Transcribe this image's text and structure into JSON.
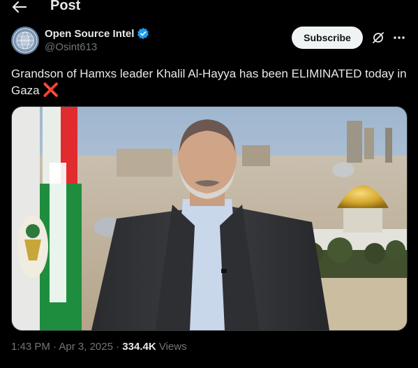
{
  "header": {
    "title": "Post",
    "back_icon": "arrow-left-icon"
  },
  "author": {
    "name": "Open Source Intel",
    "handle": "@Osint613",
    "verified": true,
    "verified_color": "#1d9bf0",
    "subscribe_label": "Subscribe"
  },
  "tweet": {
    "text": "Grandson of Hamxs leader Khalil Al-Hayya has been ELIMINATED today in Gaza",
    "emoji": "❌"
  },
  "meta": {
    "time": "1:43 PM",
    "date": "Apr 3, 2025",
    "views": "334.4K",
    "views_label": "Views"
  },
  "colors": {
    "background": "#000000",
    "text": "#e7e9ea",
    "muted": "#71767b",
    "subscribe_bg": "#eff3f4"
  }
}
